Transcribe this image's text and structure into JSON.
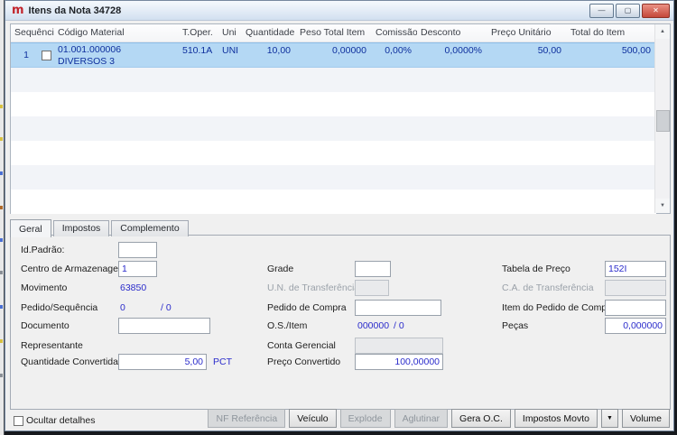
{
  "window": {
    "title": "Itens da Nota 34728"
  },
  "icons": {
    "app_logo": "m",
    "minimize": "—",
    "maximize": "▢",
    "close": "✕",
    "scroll_up": "▲",
    "scroll_down": "▼",
    "dropdown_arrow": "▼"
  },
  "grid": {
    "columns": [
      "Sequência",
      "Código Material",
      "T.Oper.",
      "Uni",
      "Quantidade",
      "Peso Total Item",
      "Comissão",
      "Desconto",
      "Preço Unitário",
      "Total do Item"
    ],
    "row": {
      "sequencia": "1",
      "codigo": "01.001.000006",
      "descricao": "DIVERSOS 3",
      "t_oper": "510.1A",
      "uni": "UNI",
      "quantidade": "10,00",
      "peso_total_item": "0,00000",
      "comissao": "0,00%",
      "desconto": "0,0000%",
      "preco_unitario": "50,00",
      "total_do_item": "500,00"
    }
  },
  "tabs": {
    "geral": "Geral",
    "impostos": "Impostos",
    "complemento": "Complemento"
  },
  "form": {
    "id_padrao": {
      "label": "Id.Padrão:",
      "value": ""
    },
    "centro_armazenagem": {
      "label": "Centro de Armazenagem",
      "value": "1"
    },
    "movimento": {
      "label": "Movimento",
      "value": "63850"
    },
    "pedido_sequencia": {
      "label": "Pedido/Sequência",
      "value": "0",
      "value2": "/ 0"
    },
    "documento": {
      "label": "Documento",
      "value": ""
    },
    "representante": {
      "label": "Representante",
      "value": ""
    },
    "quantidade_convertida": {
      "label": "Quantidade Convertida",
      "value": "5,00",
      "suffix": "PCT"
    },
    "grade": {
      "label": "Grade",
      "value": ""
    },
    "un_transferencia": {
      "label": "U.N. de Transferência",
      "value": ""
    },
    "pedido_compra": {
      "label": "Pedido de Compra",
      "value": ""
    },
    "os_item": {
      "label": "O.S./Item",
      "value": "000000",
      "value2": "/ 0"
    },
    "conta_gerencial": {
      "label": "Conta Gerencial",
      "value": ""
    },
    "preco_convertido": {
      "label": "Preço Convertido",
      "value": "100,00000"
    },
    "tabela_preco": {
      "label": "Tabela de Preço",
      "value": "152I"
    },
    "ca_transferencia": {
      "label": "C.A. de Transferência",
      "value": ""
    },
    "item_pedido_compra": {
      "label": "Item do Pedido de Compra",
      "value": ""
    },
    "pecas": {
      "label": "Peças",
      "value": "0,000000"
    }
  },
  "footer": {
    "ocultar_detalhes": "Ocultar detalhes",
    "buttons": {
      "nf_referencia": "NF Referência",
      "veiculo": "Veículo",
      "explode": "Explode",
      "aglutinar": "Aglutinar",
      "gera_oc": "Gera O.C.",
      "impostos_movto": "Impostos Movto",
      "volume": "Volume"
    }
  },
  "colors": {
    "selected_row_bg": "#b4d8f4",
    "value_blue": "#2b2ccb",
    "grid_text_navy": "#0e2f9d",
    "close_button_red": "#c4473a",
    "window_bg": "#f0f0f0"
  }
}
